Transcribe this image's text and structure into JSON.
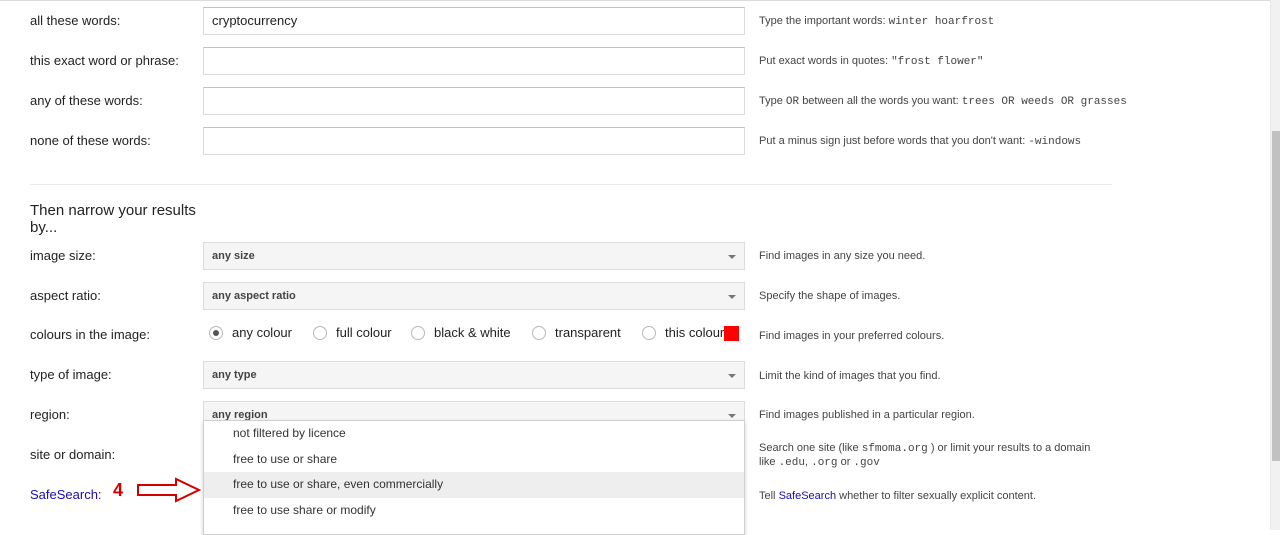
{
  "form": {
    "all_words": {
      "label": "all these words:",
      "value": "cryptocurrency",
      "hint_prefix": "Type the important words:",
      "hint_example": "winter hoarfrost"
    },
    "exact_phrase": {
      "label": "this exact word or phrase:",
      "value": "",
      "hint_prefix": "Put exact words in quotes:",
      "hint_example": "\"frost flower\""
    },
    "any_words": {
      "label": "any of these words:",
      "value": "",
      "hint_a": "Type",
      "hint_or1": "OR",
      "hint_b": "between all the words you want:",
      "hint_example": "trees OR weeds OR grasses"
    },
    "none_words": {
      "label": "none of these words:",
      "value": "",
      "hint_prefix": "Put a minus sign just before words that you don't want:",
      "hint_example": "-windows"
    }
  },
  "narrow": {
    "heading": "Then narrow your results by...",
    "image_size": {
      "label": "image size:",
      "value": "any size",
      "hint": "Find images in any size you need."
    },
    "aspect_ratio": {
      "label": "aspect ratio:",
      "value": "any aspect ratio",
      "hint": "Specify the shape of images."
    },
    "colours": {
      "label": "colours in the image:",
      "options": [
        "any colour",
        "full colour",
        "black & white",
        "transparent",
        "this colour:"
      ],
      "selected": "any colour",
      "swatch_color": "#ff0000",
      "hint": "Find images in your preferred colours."
    },
    "type_of_image": {
      "label": "type of image:",
      "value": "any type",
      "hint": "Limit the kind of images that you find."
    },
    "region": {
      "label": "region:",
      "value": "any region",
      "hint": "Find images published in a particular region."
    },
    "site": {
      "label": "site or domain:",
      "hint_a": "Search one site (like",
      "hint_site": "sfmoma.org",
      "hint_b": ") or limit your results to a domain like",
      "hint_tld1": ".edu",
      "hint_tld2": ".org",
      "hint_or": "or",
      "hint_tld3": ".gov"
    },
    "safesearch": {
      "label": "SafeSearch:",
      "hint_a": "Tell",
      "hint_link": "SafeSearch",
      "hint_b": "whether to filter sexually explicit content."
    }
  },
  "usage_dropdown": {
    "options": [
      "not filtered by licence",
      "free to use or share",
      "free to use or share, even commercially",
      "free to use share or modify"
    ],
    "highlighted": "free to use or share, even commercially"
  },
  "annotation": {
    "step": "4",
    "color": "#d40000"
  },
  "colors": {
    "link": "#1a0dab",
    "swatch": "#ff0000",
    "annotation": "#d40000"
  }
}
